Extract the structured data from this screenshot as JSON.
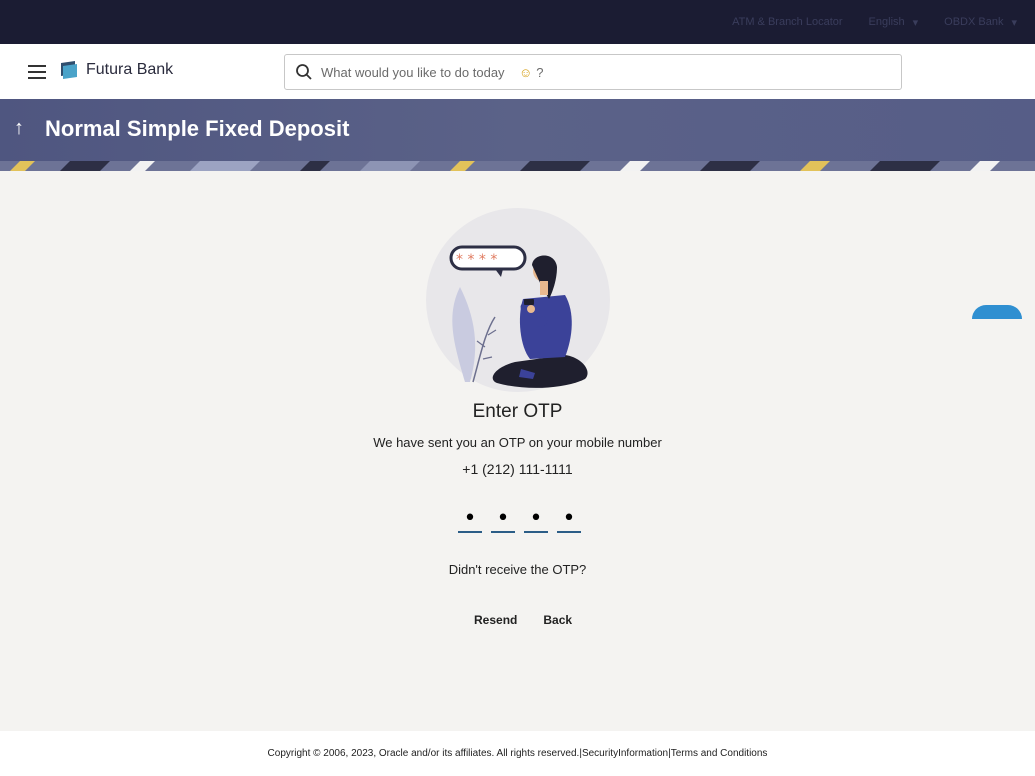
{
  "topbar": {
    "atm_branch_label": "ATM & Branch Locator",
    "language_label": "English",
    "user_label": "OBDX Bank"
  },
  "header": {
    "brand_name": "Futura Bank",
    "search_placeholder": "What would you like to do today",
    "search_suffix": "?"
  },
  "banner": {
    "title": "Normal Simple Fixed Deposit"
  },
  "otp": {
    "title": "Enter OTP",
    "subtitle": "We have sent you an OTP on your mobile number",
    "phone": "+1 (212) 111-1111",
    "digits": [
      "•",
      "•",
      "•",
      "•"
    ],
    "not_received": "Didn't receive the OTP?",
    "resend_label": "Resend",
    "back_label": "Back"
  },
  "footer": {
    "copyright": "Copyright © 2006, 2023, Oracle and/or its affiliates. All rights reserved.",
    "security_label": "SecurityInformation",
    "terms_label": "Terms and Conditions",
    "separator": "|"
  },
  "colors": {
    "topbar": "#1b1c33",
    "banner": "#565d87",
    "otp_underline": "#2b5d87",
    "chat_bubble": "#2f8fd1"
  }
}
